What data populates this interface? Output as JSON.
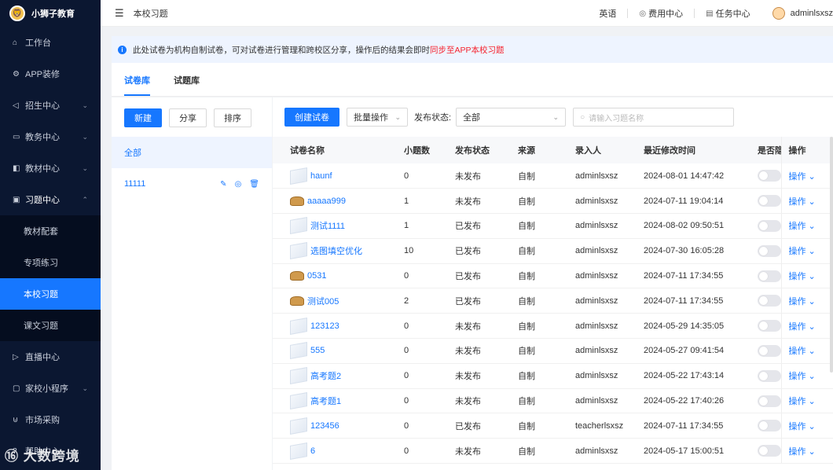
{
  "brand": {
    "name": "小狮子教育",
    "logo_icon": "lion-logo"
  },
  "sidebar": {
    "items": [
      {
        "label": "工作台",
        "icon": "home-icon",
        "arrow": ""
      },
      {
        "label": "APP装修",
        "icon": "settings-icon",
        "arrow": ""
      },
      {
        "label": "招生中心",
        "icon": "megaphone-icon",
        "arrow": "⌄"
      },
      {
        "label": "教务中心",
        "icon": "folder-icon",
        "arrow": "⌄"
      },
      {
        "label": "教材中心",
        "icon": "book-icon",
        "arrow": "⌄"
      },
      {
        "label": "习题中心",
        "icon": "exercise-icon",
        "arrow": "⌃"
      }
    ],
    "sub_items": [
      "教材配套",
      "专项练习",
      "本校习题",
      "课文习题"
    ],
    "items_after": [
      {
        "label": "直播中心",
        "icon": "live-icon",
        "arrow": ""
      },
      {
        "label": "家校小程序",
        "icon": "miniprogram-icon",
        "arrow": "⌄"
      },
      {
        "label": "市场采购",
        "icon": "cart-icon",
        "arrow": ""
      },
      {
        "label": "帮助中心",
        "icon": "help-icon",
        "arrow": ""
      }
    ],
    "watermark": "大数跨境"
  },
  "header": {
    "breadcrumb": "本校习题",
    "language": "英语",
    "fee_center": "费用中心",
    "task_center": "任务中心",
    "username": "adminlsxsz"
  },
  "notice": {
    "text": "此处试卷为机构自制试卷，可对试卷进行管理和跨校区分享，操作后的结果会即时",
    "highlight": "同步至APP本校习题",
    "highlight_color": "#f5222d"
  },
  "tabs": [
    "试卷库",
    "试题库"
  ],
  "left_panel": {
    "buttons": {
      "new": "新建",
      "share": "分享",
      "sort": "排序"
    },
    "categories": [
      "全部",
      "11111"
    ]
  },
  "toolbar": {
    "create": "创建试卷",
    "batch": "批量操作",
    "status_label": "发布状态:",
    "status_value": "全部",
    "search_placeholder": "请输入习题名称"
  },
  "table": {
    "headers": [
      "试卷名称",
      "小题数",
      "发布状态",
      "来源",
      "录入人",
      "最近修改时间",
      "是否隐藏",
      "操作"
    ],
    "op_label": "操作",
    "rows": [
      {
        "name": "haunf",
        "count": "0",
        "status": "未发布",
        "source": "自制",
        "author": "adminlsxsz",
        "time": "2024-08-01 14:47:42",
        "thumb": "doc"
      },
      {
        "name": "aaaaa999",
        "count": "1",
        "status": "未发布",
        "source": "自制",
        "author": "adminlsxsz",
        "time": "2024-07-11 19:04:14",
        "thumb": "img"
      },
      {
        "name": "测试1111",
        "count": "1",
        "status": "已发布",
        "source": "自制",
        "author": "adminlsxsz",
        "time": "2024-08-02 09:50:51",
        "thumb": "doc"
      },
      {
        "name": "选图填空优化",
        "count": "10",
        "status": "已发布",
        "source": "自制",
        "author": "adminlsxsz",
        "time": "2024-07-30 16:05:28",
        "thumb": "doc"
      },
      {
        "name": "0531",
        "count": "0",
        "status": "已发布",
        "source": "自制",
        "author": "adminlsxsz",
        "time": "2024-07-11 17:34:55",
        "thumb": "img"
      },
      {
        "name": "测试005",
        "count": "2",
        "status": "已发布",
        "source": "自制",
        "author": "adminlsxsz",
        "time": "2024-07-11 17:34:55",
        "thumb": "img"
      },
      {
        "name": "123123",
        "count": "0",
        "status": "未发布",
        "source": "自制",
        "author": "adminlsxsz",
        "time": "2024-05-29 14:35:05",
        "thumb": "doc"
      },
      {
        "name": "555",
        "count": "0",
        "status": "未发布",
        "source": "自制",
        "author": "adminlsxsz",
        "time": "2024-05-27 09:41:54",
        "thumb": "doc"
      },
      {
        "name": "高考题2",
        "count": "0",
        "status": "未发布",
        "source": "自制",
        "author": "adminlsxsz",
        "time": "2024-05-22 17:43:14",
        "thumb": "doc"
      },
      {
        "name": "高考题1",
        "count": "0",
        "status": "未发布",
        "source": "自制",
        "author": "adminlsxsz",
        "time": "2024-05-22 17:40:26",
        "thumb": "doc"
      },
      {
        "name": "123456",
        "count": "0",
        "status": "已发布",
        "source": "自制",
        "author": "teacherlsxsz",
        "time": "2024-07-11 17:34:55",
        "thumb": "doc"
      },
      {
        "name": "6",
        "count": "0",
        "status": "未发布",
        "source": "自制",
        "author": "adminlsxsz",
        "time": "2024-05-17 15:00:51",
        "thumb": "doc"
      }
    ]
  },
  "colors": {
    "primary": "#1677ff",
    "sidebar_bg": "#0b1731",
    "active_bg": "#1677ff"
  }
}
